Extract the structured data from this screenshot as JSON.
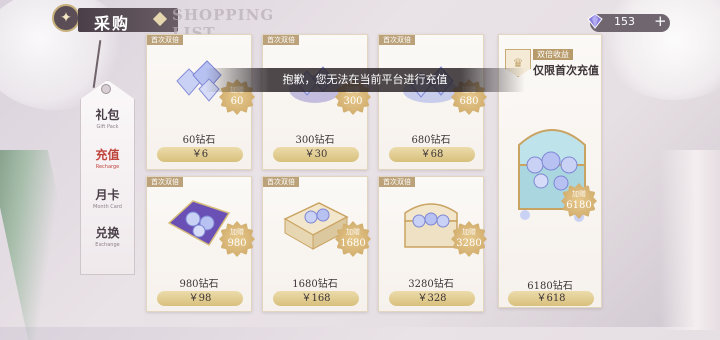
{
  "header": {
    "title": "采购",
    "subtitle": "SHOPPING LIST"
  },
  "currency": {
    "value": "153",
    "add_label": "+"
  },
  "sidebar": {
    "items": [
      {
        "cn": "礼包",
        "en": "Gift Pack",
        "active": false
      },
      {
        "cn": "充值",
        "en": "Recharge",
        "active": true
      },
      {
        "cn": "月卡",
        "en": "Month Card",
        "active": false
      },
      {
        "cn": "兑换",
        "en": "Exchange",
        "active": false
      }
    ]
  },
  "toast": "抱歉，您无法在当前平台进行充值",
  "cards": [
    {
      "badge": "首次双倍",
      "bonus_label": "加赠",
      "bonus": "60",
      "amount": "60钻石",
      "price": "￥6"
    },
    {
      "badge": "首次双倍",
      "bonus_label": "加赠",
      "bonus": "300",
      "amount": "300钻石",
      "price": "￥30"
    },
    {
      "badge": "首次双倍",
      "bonus_label": "加赠",
      "bonus": "680",
      "amount": "680钻石",
      "price": "￥68"
    },
    {
      "badge": "首次双倍",
      "bonus_label": "加赠",
      "bonus": "980",
      "amount": "980钻石",
      "price": "￥98"
    },
    {
      "badge": "首次双倍",
      "bonus_label": "加赠",
      "bonus": "1680",
      "amount": "1680钻石",
      "price": "￥168"
    },
    {
      "badge": "首次双倍",
      "bonus_label": "加赠",
      "bonus": "3280",
      "amount": "3280钻石",
      "price": "￥328"
    }
  ],
  "big_card": {
    "tagline": "双倍收益",
    "headline": "仅限首次充值",
    "bonus_label": "加赠",
    "bonus": "6180",
    "amount": "6180钻石",
    "price": "￥618"
  },
  "colors": {
    "accent_gold": "#d8bf7c",
    "active_red": "#c0463d",
    "gem_purple": "#7a6bd8"
  }
}
